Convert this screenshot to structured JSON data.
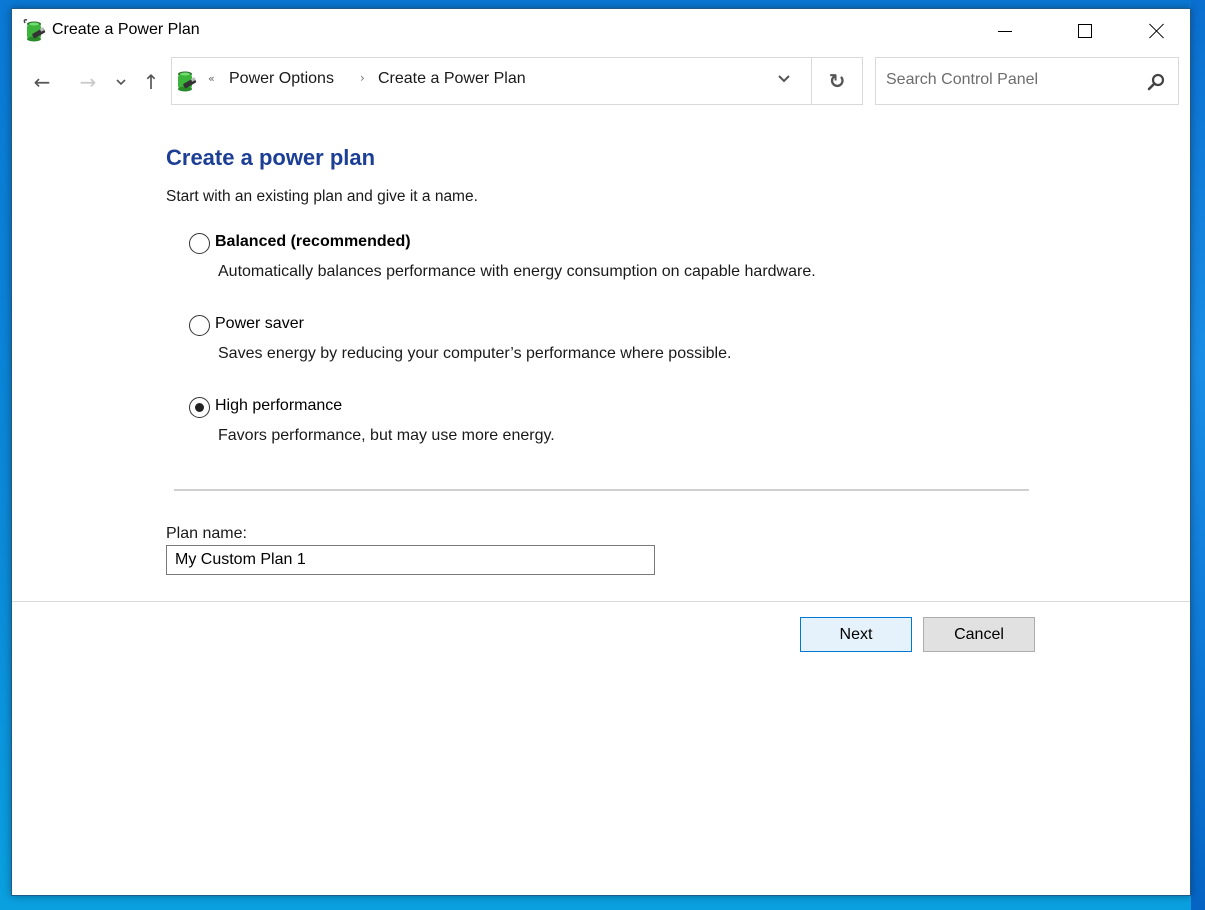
{
  "window": {
    "title": "Create a Power Plan",
    "icon": "power-options-battery-icon",
    "controls": {
      "minimize": "minimize-icon",
      "maximize": "maximize-icon",
      "close": "close-icon"
    }
  },
  "nav": {
    "back": "←",
    "forward": "→",
    "recent": "⌄",
    "up": "↑",
    "refresh": "↻"
  },
  "address": {
    "overflow": "«",
    "breadcrumbs": [
      {
        "label": "Power Options"
      },
      {
        "label": "Create a Power Plan"
      }
    ],
    "separator": "›",
    "dropdown": "⌄"
  },
  "search": {
    "placeholder": "Search Control Panel",
    "value": ""
  },
  "main": {
    "title": "Create a power plan",
    "subtitle": "Start with an existing plan and give it a name.",
    "options": [
      {
        "label": "Balanced (recommended)",
        "description": "Automatically balances performance with energy consumption on capable hardware.",
        "checked": false,
        "bold": true
      },
      {
        "label": "Power saver",
        "description": "Saves energy by reducing your computer’s performance where possible.",
        "checked": false,
        "bold": false
      },
      {
        "label": "High performance",
        "description": "Favors performance, but may use more energy.",
        "checked": true,
        "bold": false
      }
    ],
    "plan_name_label": "Plan name:",
    "plan_name_value": "My Custom Plan 1"
  },
  "buttons": {
    "next": "Next",
    "cancel": "Cancel"
  },
  "colors": {
    "title_blue": "#1c3f95",
    "next_border": "#0078d7",
    "next_bg": "#e5f1fb",
    "cancel_bg": "#e1e1e1"
  }
}
